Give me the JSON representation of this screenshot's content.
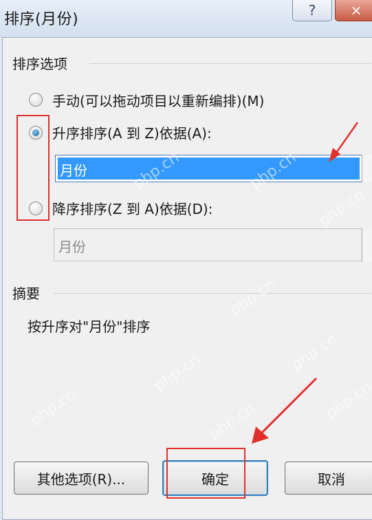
{
  "window": {
    "title": "排序(月份)",
    "help_glyph": "?",
    "close_glyph": "×"
  },
  "sort_options": {
    "group_label": "排序选项",
    "manual_label": "手动(可以拖动项目以重新编排)(M)",
    "ascending_label": "升序排序(A 到 Z)依据(A):",
    "ascending_value": "月份",
    "descending_label": "降序排序(Z 到 A)依据(D):",
    "descending_value": "月份",
    "selected": "ascending"
  },
  "summary": {
    "group_label": "摘要",
    "text": "按升序对\"月份\"排序"
  },
  "buttons": {
    "more_options": "其他选项(R)...",
    "ok": "确定",
    "cancel": "取消"
  },
  "watermark": "php.cn",
  "colors": {
    "selection": "#3399ff",
    "annotation": "#e0302c",
    "dialog_bg": "#f0f0f0"
  }
}
